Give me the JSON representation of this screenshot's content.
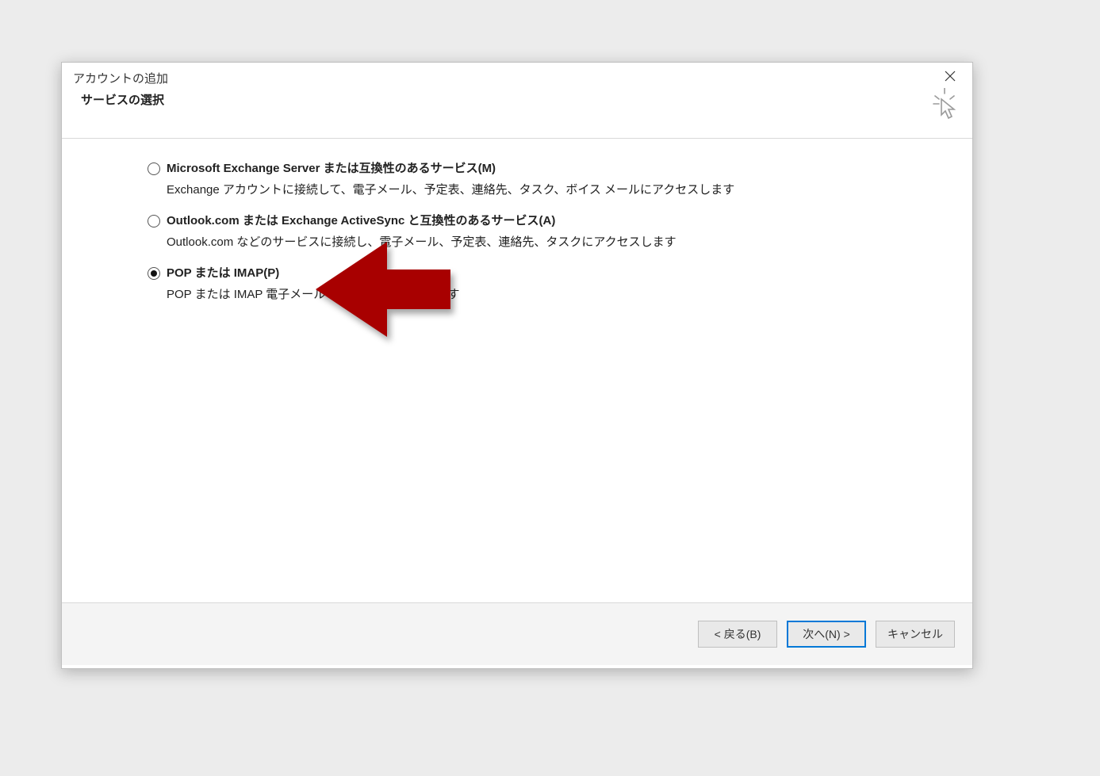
{
  "dialog": {
    "title": "アカウントの追加",
    "heading": "サービスの選択"
  },
  "options": [
    {
      "label": "Microsoft Exchange Server または互換性のあるサービス(M)",
      "desc": "Exchange アカウントに接続して、電子メール、予定表、連絡先、タスク、ボイス メールにアクセスします",
      "selected": false
    },
    {
      "label": "Outlook.com または Exchange ActiveSync と互換性のあるサービス(A)",
      "desc": "Outlook.com などのサービスに接続し、電子メール、予定表、連絡先、タスクにアクセスします",
      "selected": false
    },
    {
      "label": "POP または IMAP(P)",
      "desc": "POP または IMAP 電子メール アカウントに接続します",
      "selected": true
    }
  ],
  "buttons": {
    "back": "< 戻る(B)",
    "next": "次へ(N) >",
    "cancel": "キャンセル"
  },
  "annotation": {
    "arrow_color": "#a80000"
  }
}
